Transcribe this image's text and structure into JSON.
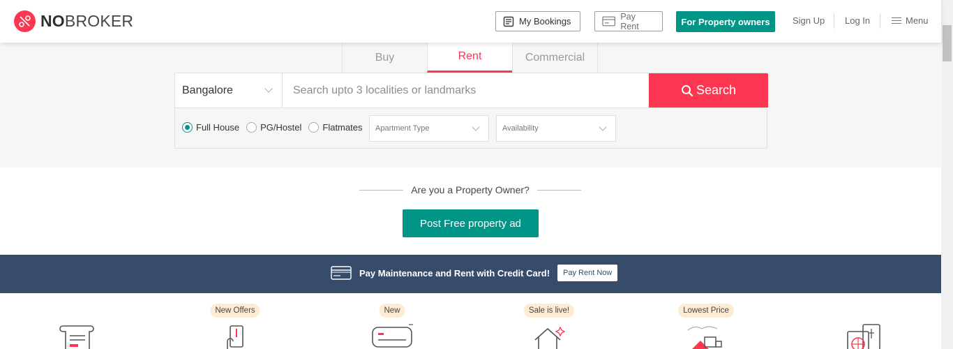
{
  "brand": {
    "name_bold": "NO",
    "name_rest": "BROKER",
    "accent": "#fd3752",
    "green": "#009587"
  },
  "header": {
    "my_bookings": "My Bookings",
    "pay_rent": "Pay Rent",
    "for_owners": "For Property owners",
    "sign_up": "Sign Up",
    "log_in": "Log In",
    "menu": "Menu"
  },
  "search": {
    "tabs": [
      {
        "label": "Buy",
        "active": false
      },
      {
        "label": "Rent",
        "active": true
      },
      {
        "label": "Commercial",
        "active": false
      }
    ],
    "city": "Bangalore",
    "placeholder": "Search upto 3 localities or landmarks",
    "button": "Search",
    "types": [
      {
        "label": "Full House",
        "selected": true
      },
      {
        "label": "PG/Hostel",
        "selected": false
      },
      {
        "label": "Flatmates",
        "selected": false
      }
    ],
    "apartment_type": "Apartment Type",
    "availability": "Availability"
  },
  "owner": {
    "question": "Are you a Property Owner?",
    "post_button": "Post Free property ad"
  },
  "banner": {
    "text": "Pay Maintenance and Rent with Credit Card!",
    "button": "Pay Rent Now",
    "bg": "#374c6b"
  },
  "services": [
    {
      "badge": "",
      "icon": "rental-agreement-icon"
    },
    {
      "badge": "New Offers",
      "icon": "pay-with-card-icon"
    },
    {
      "badge": "New",
      "icon": "air-conditioner-icon"
    },
    {
      "badge": "Sale is live!",
      "icon": "home-cleaning-icon"
    },
    {
      "badge": "Lowest Price",
      "icon": "packers-movers-icon"
    },
    {
      "badge": "",
      "icon": "nri-services-icon"
    }
  ]
}
